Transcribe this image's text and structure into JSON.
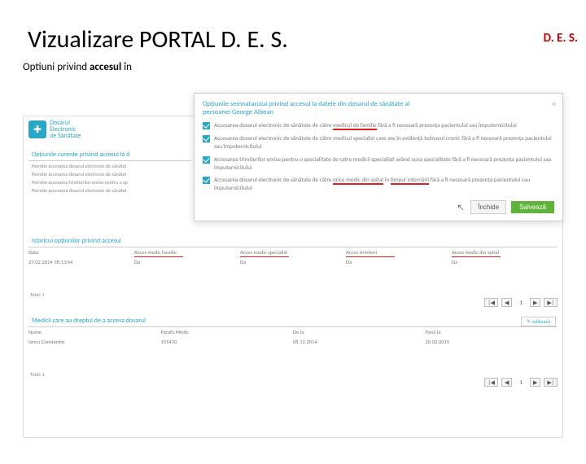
{
  "corner": "D. E. S.",
  "title": "Vizualizare PORTAL D. E. S.",
  "subtitle_pre": "Optiuni privind ",
  "subtitle_bold": "accesul",
  "subtitle_post": " în",
  "logo": {
    "line1": "Dosarul",
    "line2": "Electronic",
    "line3": "de Sănătate"
  },
  "bg": {
    "sec1_title": "Opțiunile curente privind accesul la d",
    "l1": "Permite accesarea dosarul electronic de sănătat",
    "l2": "Permite accesarea dosarul electronic de sănătat",
    "l3": "Permite accesarea trimiterilor emise pentru o sp",
    "l4": "Permite accesarea dosarul electronic de sănătat"
  },
  "hist": {
    "title": "Istoricul opțiunilor privind accesul",
    "h1": "Data",
    "h2": "Acces medic familie",
    "h3": "Acces medic specialist",
    "h4": "Acces trimiteri",
    "h5": "Acces medic din spital",
    "r1": "27.02.2014 18:13:54",
    "r2": "Da",
    "r3": "Da",
    "r4": "Da",
    "r5": "Da",
    "total": "Total: 1"
  },
  "pager": {
    "first": "|◀",
    "prev": "◀",
    "page": "1",
    "next": "▶",
    "last": "▶|"
  },
  "medici": {
    "title": "Medicii care au dreptul de a accesa dosarul",
    "edit": "✎  editează",
    "h1": "Nume",
    "h2": "Parafă Medic",
    "h3": "De la",
    "h4": "Pană la",
    "r1": "Iancu Constantin",
    "r2": "155430",
    "r3": "08.12.2014",
    "r4": "20.02.2015",
    "total": "Total: 1"
  },
  "modal": {
    "title": "Opțiunile semnatarului privind accesul la datele din dosarul de sănătate al persoanei George Albean",
    "c1a": "Accesarea dosarul electronic de sănătate de către ",
    "c1u": "medicul de familie",
    "c1b": " fără a fi necesară prezența pacientului sau împuternicitului",
    "c2": "Accesarea dosarul electronic de sănătate de către medicul specialist care are în evidență bolnavul cronic fără a fi necesară prezența pacientului sau împuternicitului",
    "c3": "Accesarea trimiterilor emise pentru o specialitate de catre medicii specialiști având acea specialitate fără a fi necesară prezența pacientului sau împuternicitului",
    "c4a": "Accesarea dosarul electronic de sănătate de către ",
    "c4u1": "orice medic din spital",
    "c4m": " în ",
    "c4u2": "timpul internării",
    "c4b": " fără a fi necesară prezența pacientului sau împuternicitului",
    "cancel": "Închide",
    "save": "Salvează"
  }
}
